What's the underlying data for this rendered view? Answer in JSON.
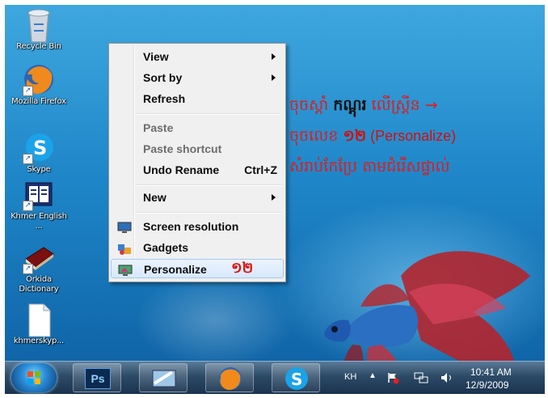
{
  "desktop_icons": [
    {
      "label": "Recycle Bin",
      "icon": "recycle-bin-icon"
    },
    {
      "label": "Mozilla Firefox",
      "icon": "firefox-icon"
    },
    {
      "label": "Skype",
      "icon": "skype-icon"
    },
    {
      "label": "Khmer English ...",
      "icon": "book-icon"
    },
    {
      "label": "Orkida Dictionary",
      "icon": "dictionary-icon"
    },
    {
      "label": "khmerskyp...",
      "icon": "file-icon"
    }
  ],
  "context_menu": {
    "view": "View",
    "sort_by": "Sort by",
    "refresh": "Refresh",
    "paste": "Paste",
    "paste_shortcut": "Paste shortcut",
    "undo_rename": "Undo Rename",
    "undo_rename_accel": "Ctrl+Z",
    "new": "New",
    "screen_resolution": "Screen resolution",
    "gadgets": "Gadgets",
    "personalize": "Personalize",
    "annotation_number": "១២"
  },
  "instructions": {
    "line1_a": "ចុចស្តាំ ",
    "line1_b": "កណ្តុរ",
    "line1_c": " លើស្រ្គីន →",
    "line2_a": "ចុចលេខ ",
    "line2_num": "១២",
    "line2_b": " (Personalize)",
    "line3": "សំរាប់កែប្រែ តាមជំរើសផ្ទាល់"
  },
  "taskbar": {
    "buttons": [
      "start-orb-icon",
      "photoshop-icon",
      "file-manager-icon",
      "firefox-icon",
      "skype-icon"
    ],
    "ps_label": "Ps",
    "tray": {
      "language": "KH",
      "arrow": "▲",
      "time": "10:41 AM",
      "date": "12/9/2009"
    }
  },
  "colors": {
    "annotation_red": "#e01010",
    "menu_bg": "#f0f0f0",
    "desktop_blue": "#1e86c8"
  }
}
